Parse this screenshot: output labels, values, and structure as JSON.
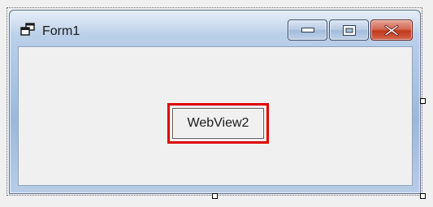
{
  "window": {
    "title": "Form1",
    "icon": "form-window-icon",
    "controls": {
      "minimize_icon": "minimize-icon",
      "maximize_icon": "maximize-icon",
      "close_icon": "close-icon"
    }
  },
  "form": {
    "button_label": "WebView2",
    "highlight_color": "#e00000"
  },
  "colors": {
    "title_bar": "#a9c3e2",
    "close_button": "#c0391f",
    "client_background": "#f0f0f0"
  }
}
